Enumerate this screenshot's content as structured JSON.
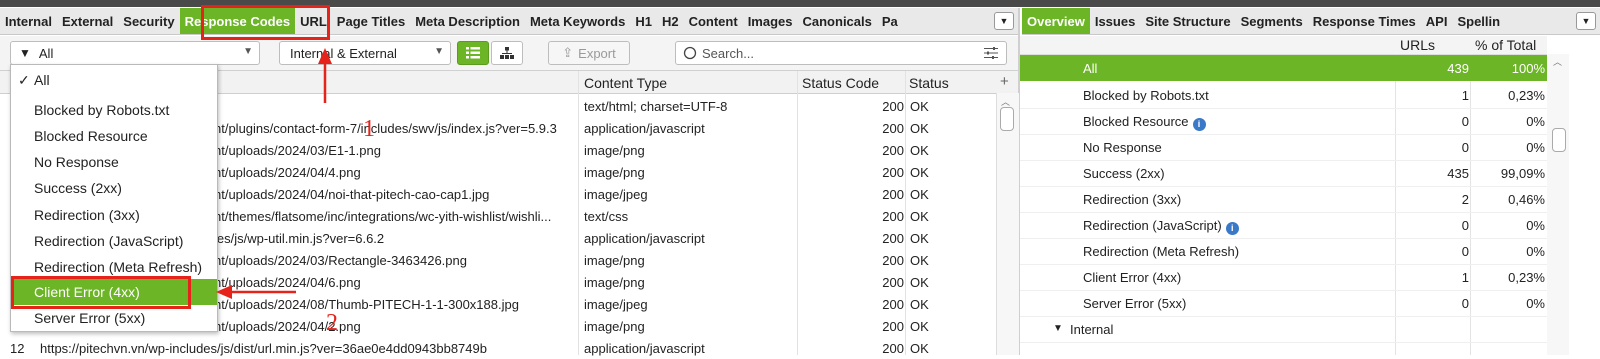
{
  "left_tabs": [
    "Internal",
    "External",
    "Security",
    "Response Codes",
    "URL",
    "Page Titles",
    "Meta Description",
    "Meta Keywords",
    "H1",
    "H2",
    "Content",
    "Images",
    "Canonicals",
    "Pa"
  ],
  "right_tabs": [
    "Overview",
    "Issues",
    "Site Structure",
    "Segments",
    "Response Times",
    "API",
    "Spellin"
  ],
  "toolbar": {
    "filter_label": "All",
    "scope_label": "Internal & External",
    "export_label": "Export",
    "search_placeholder": "Search..."
  },
  "grid": {
    "headers": {
      "url": "",
      "content_type": "Content Type",
      "status_code": "Status Code",
      "status": "Status"
    },
    "rows": [
      {
        "url": "",
        "type": "text/html; charset=UTF-8",
        "code": "200",
        "status": "OK"
      },
      {
        "url": "nt/plugins/contact-form-7/includes/swv/js/index.js?ver=5.9.3",
        "type": "application/javascript",
        "code": "200",
        "status": "OK"
      },
      {
        "url": "nt/uploads/2024/03/E1-1.png",
        "type": "image/png",
        "code": "200",
        "status": "OK"
      },
      {
        "url": "nt/uploads/2024/04/4.png",
        "type": "image/png",
        "code": "200",
        "status": "OK"
      },
      {
        "url": "nt/uploads/2024/04/noi-that-pitech-cao-cap1.jpg",
        "type": "image/jpeg",
        "code": "200",
        "status": "OK"
      },
      {
        "url": "nt/themes/flatsome/inc/integrations/wc-yith-wishlist/wishli...",
        "type": "text/css",
        "code": "200",
        "status": "OK"
      },
      {
        "url": "les/js/wp-util.min.js?ver=6.6.2",
        "type": "application/javascript",
        "code": "200",
        "status": "OK"
      },
      {
        "url": "nt/uploads/2024/03/Rectangle-3463426.png",
        "type": "image/png",
        "code": "200",
        "status": "OK"
      },
      {
        "url": "nt/uploads/2024/04/6.png",
        "type": "image/png",
        "code": "200",
        "status": "OK"
      },
      {
        "url": "nt/uploads/2024/08/Thumb-PITECH-1-1-300x188.jpg",
        "type": "image/jpeg",
        "code": "200",
        "status": "OK"
      },
      {
        "url": "nt/uploads/2024/04/2.png",
        "type": "image/png",
        "code": "200",
        "status": "OK"
      },
      {
        "url": "https://pitechvn.vn/wp-includes/js/dist/url.min.js?ver=36ae0e4dd0943bb8749b",
        "type": "application/javascript",
        "code": "200",
        "status": "OK"
      }
    ],
    "last_row_number": "12"
  },
  "dropdown": {
    "items": [
      "All",
      "Blocked by Robots.txt",
      "Blocked Resource",
      "No Response",
      "Success (2xx)",
      "Redirection (3xx)",
      "Redirection (JavaScript)",
      "Redirection (Meta Refresh)",
      "Client Error (4xx)",
      "Server Error (5xx)"
    ],
    "selected": "Client Error (4xx)",
    "checked": "All",
    "check_mark": "✓"
  },
  "annotations": {
    "step1": "1",
    "step2": "2"
  },
  "overview": {
    "headers": {
      "urls": "URLs",
      "pct": "% of Total"
    },
    "rows": [
      {
        "label": "All",
        "urls": "439",
        "pct": "100%"
      },
      {
        "label": "Blocked by Robots.txt",
        "urls": "1",
        "pct": "0,23%"
      },
      {
        "label": "Blocked Resource",
        "urls": "0",
        "pct": "0%"
      },
      {
        "label": "No Response",
        "urls": "0",
        "pct": "0%"
      },
      {
        "label": "Success (2xx)",
        "urls": "435",
        "pct": "99,09%"
      },
      {
        "label": "Redirection (3xx)",
        "urls": "2",
        "pct": "0,46%"
      },
      {
        "label": "Redirection (JavaScript)",
        "urls": "0",
        "pct": "0%"
      },
      {
        "label": "Redirection (Meta Refresh)",
        "urls": "0",
        "pct": "0%"
      },
      {
        "label": "Client Error (4xx)",
        "urls": "1",
        "pct": "0,23%"
      },
      {
        "label": "Server Error (5xx)",
        "urls": "0",
        "pct": "0%"
      }
    ],
    "section_label": "Internal"
  },
  "colors": {
    "accent": "#6cb526",
    "annotation_red": "#e5231b"
  }
}
